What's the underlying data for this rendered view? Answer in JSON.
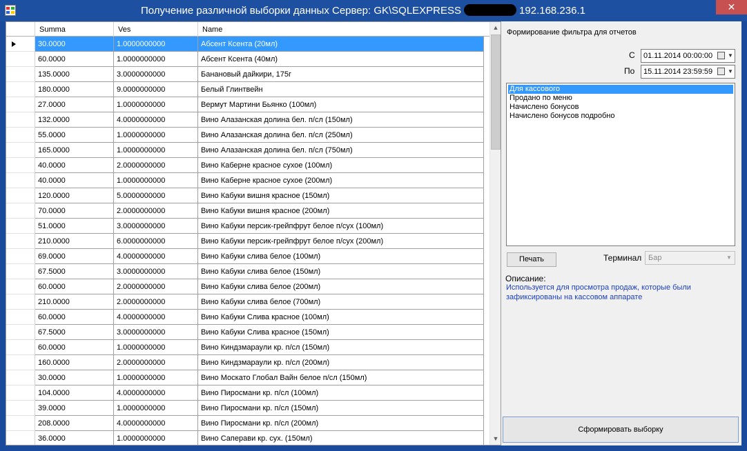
{
  "window": {
    "title_prefix": "Получение различной выборки данных  Сервер: GK\\SQLEXPRESS",
    "title_suffix": "192.168.236.1",
    "close_glyph": "✕",
    "title_bar_color": "#1e50a2"
  },
  "grid": {
    "columns": [
      "Summa",
      "Ves",
      "Name"
    ],
    "rows": [
      {
        "summa": "30.0000",
        "ves": "1.0000000000",
        "name": "Абсент Ксента (20мл)"
      },
      {
        "summa": "60.0000",
        "ves": "1.0000000000",
        "name": "Абсент Ксента (40мл)"
      },
      {
        "summa": "135.0000",
        "ves": "3.0000000000",
        "name": "Банановый дайкири, 175г"
      },
      {
        "summa": "180.0000",
        "ves": "9.0000000000",
        "name": "Белый Глинтвейн"
      },
      {
        "summa": "27.0000",
        "ves": "1.0000000000",
        "name": "Вермут Мартини Бьянко (100мл)"
      },
      {
        "summa": "132.0000",
        "ves": "4.0000000000",
        "name": "Вино Алазанская долина бел. п/сл (150мл)"
      },
      {
        "summa": "55.0000",
        "ves": "1.0000000000",
        "name": "Вино Алазанская долина бел. п/сл (250мл)"
      },
      {
        "summa": "165.0000",
        "ves": "1.0000000000",
        "name": "Вино Алазанская долина бел. п/сл (750мл)"
      },
      {
        "summa": "40.0000",
        "ves": "2.0000000000",
        "name": "Вино Каберне красное сухое (100мл)"
      },
      {
        "summa": "40.0000",
        "ves": "1.0000000000",
        "name": "Вино Каберне красное сухое (200мл)"
      },
      {
        "summa": "120.0000",
        "ves": "5.0000000000",
        "name": "Вино Кабуки вишня красное (150мл)"
      },
      {
        "summa": "70.0000",
        "ves": "2.0000000000",
        "name": "Вино Кабуки вишня красное (200мл)"
      },
      {
        "summa": "51.0000",
        "ves": "3.0000000000",
        "name": "Вино Кабуки персик-грейпфрут белое п/сух (100мл)"
      },
      {
        "summa": "210.0000",
        "ves": "6.0000000000",
        "name": "Вино Кабуки персик-грейпфрут белое п/сух (200мл)"
      },
      {
        "summa": "69.0000",
        "ves": "4.0000000000",
        "name": "Вино Кабуки слива белое (100мл)"
      },
      {
        "summa": "67.5000",
        "ves": "3.0000000000",
        "name": "Вино Кабуки слива белое (150мл)"
      },
      {
        "summa": "60.0000",
        "ves": "2.0000000000",
        "name": "Вино Кабуки слива белое (200мл)"
      },
      {
        "summa": "210.0000",
        "ves": "2.0000000000",
        "name": "Вино Кабуки слива белое (700мл)"
      },
      {
        "summa": "60.0000",
        "ves": "4.0000000000",
        "name": "Вино Кабуки Слива красное (100мл)"
      },
      {
        "summa": "67.5000",
        "ves": "3.0000000000",
        "name": "Вино Кабуки Слива красное (150мл)"
      },
      {
        "summa": "60.0000",
        "ves": "1.0000000000",
        "name": "Вино Киндзмараули кр. п/сл (150мл)"
      },
      {
        "summa": "160.0000",
        "ves": "2.0000000000",
        "name": "Вино Киндзмараули кр. п/сл (200мл)"
      },
      {
        "summa": "30.0000",
        "ves": "1.0000000000",
        "name": "Вино Москато Глобал Вайн белое п/сл (150мл)"
      },
      {
        "summa": "104.0000",
        "ves": "4.0000000000",
        "name": "Вино Пиросмани кр. п/сл (100мл)"
      },
      {
        "summa": "39.0000",
        "ves": "1.0000000000",
        "name": "Вино Пиросмани кр. п/сл (150мл)"
      },
      {
        "summa": "208.0000",
        "ves": "4.0000000000",
        "name": "Вино Пиросмани кр. п/сл (200мл)"
      },
      {
        "summa": "36.0000",
        "ves": "1.0000000000",
        "name": "Вино Саперави кр. сух. (150мл)"
      }
    ],
    "selected_index": 0,
    "selection_color": "#3399ff"
  },
  "filter": {
    "title": "Формирование фильтра для отчетов",
    "from_label": "С",
    "from_value": "01.11.2014 00:00:00",
    "to_label": "По",
    "to_value": "15.11.2014 23:59:59",
    "reports": [
      "Для кассового",
      "Продано по меню",
      "Начислено бонусов",
      "Начислено бонусов подробно"
    ],
    "selected_report": 0,
    "print_button": "Печать",
    "terminal_label": "Терминал",
    "terminal_value": "Бар",
    "description_label": "Описание:",
    "description_text": "Используется для просмотра продаж, которые были зафиксированы на кассовом аппарате",
    "description_color": "#1c3fbf",
    "generate_button": "Сформировать выборку"
  }
}
